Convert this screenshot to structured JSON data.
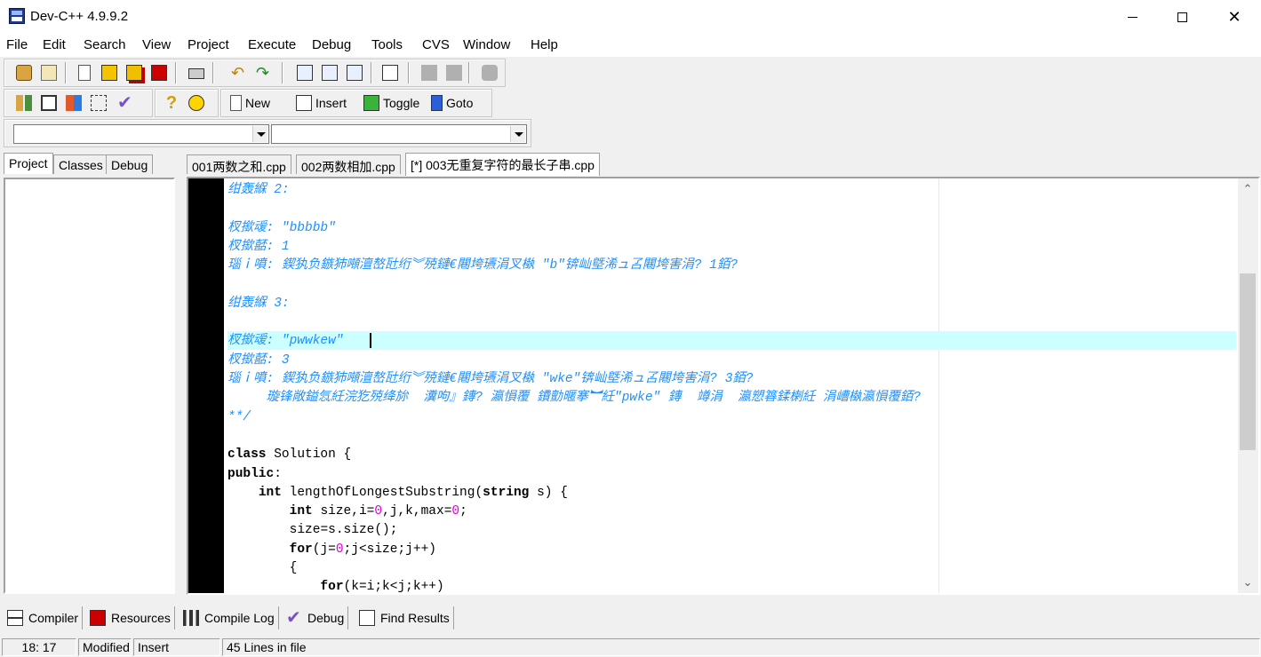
{
  "window": {
    "title": "Dev-C++ 4.9.9.2"
  },
  "menu": [
    "File",
    "Edit",
    "Search",
    "View",
    "Project",
    "Execute",
    "Debug",
    "Tools",
    "CVS",
    "Window",
    "Help"
  ],
  "toolbar2": {
    "new_label": "New",
    "insert_label": "Insert",
    "toggle_label": "Toggle",
    "goto_label": "Goto"
  },
  "left_tabs": [
    "Project",
    "Classes",
    "Debug"
  ],
  "file_tabs": [
    "001两数之和.cpp",
    "002两数相加.cpp",
    "[*] 003无重复字符的最长子串.cpp"
  ],
  "code_lines": [
    {
      "text": "绀轰緥 2:",
      "kind": "cmt"
    },
    {
      "text": "",
      "kind": "cmt"
    },
    {
      "text": "杈撳叆: \"bbbbb\"",
      "kind": "cmt"
    },
    {
      "text": "杈撳嚭: 1",
      "kind": "cmt"
    },
    {
      "text": "瑙ｉ噴: 鍥犱负鏃犻噸澶嶅瓧绗︾殑鏈€闀垮瓙涓叉槸 \"b\"锛屾墍浠ュ叾闀垮害涓? 1銆?",
      "kind": "cmt"
    },
    {
      "text": "",
      "kind": "cmt"
    },
    {
      "text": "绀轰緥 3:",
      "kind": "cmt"
    },
    {
      "text": "",
      "kind": "cmt"
    },
    {
      "text": "杈撳叆: \"pwwkew\"",
      "kind": "cmt"
    },
    {
      "text": "杈撳嚭: 3",
      "kind": "cmt"
    },
    {
      "text": "瑙ｉ噴: 鍥犱负鏃犻噸澶嶅瓧绗︾殑鏈€闀垮瓙涓叉槸 \"wke\"锛屾墍浠ュ叾闀垮害涓? 3銆?",
      "kind": "cmt"
    },
    {
      "text": "     璇锋敞鎰忥紝浣犵殑绛旀  瀵呴』鏄? 瀛愪覆 鐨勯暱搴︼紝\"pwke\" 鏄  竴涓  瀛愬簭鍒楋紝 涓嶆槸瀛愪覆銆?",
      "kind": "cmt"
    },
    {
      "text": "**/",
      "kind": "cmt"
    },
    {
      "text": "",
      "kind": "plain"
    },
    {
      "text": "class Solution {",
      "kind": "code"
    },
    {
      "text": "public:",
      "kind": "code"
    },
    {
      "text": "    int lengthOfLongestSubstring(string s) {",
      "kind": "code"
    },
    {
      "text": "        int size,i=0,j,k,max=0;",
      "kind": "code"
    },
    {
      "text": "        size=s.size();",
      "kind": "code"
    },
    {
      "text": "        for(j=0;j<size;j++)",
      "kind": "code"
    },
    {
      "text": "        {",
      "kind": "code"
    },
    {
      "text": "            for(k=i;k<j;k++)",
      "kind": "code"
    }
  ],
  "bottom_tabs": [
    "Compiler",
    "Resources",
    "Compile Log",
    "Debug",
    "Find Results"
  ],
  "status": {
    "position": "18: 17",
    "modified": "Modified",
    "mode": "Insert",
    "lines": "45 Lines in file"
  }
}
